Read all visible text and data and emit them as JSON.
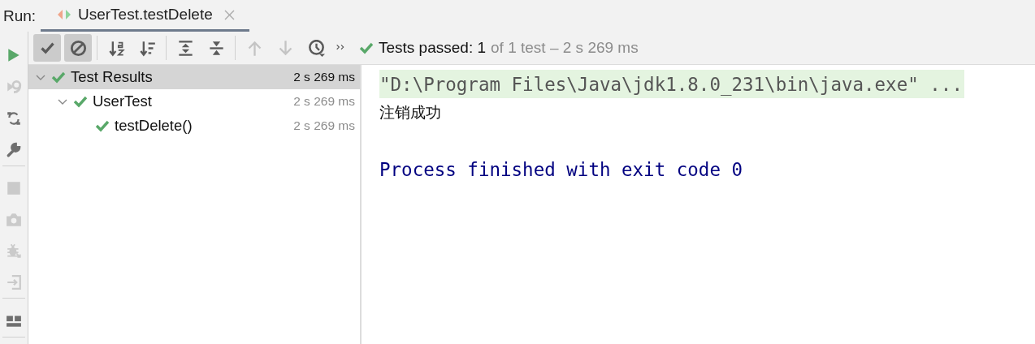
{
  "run_label": "Run:",
  "tab": {
    "label": "UserTest.testDelete",
    "selected": true
  },
  "side_tools": [
    [
      {
        "kind": "play",
        "disabled": false
      },
      {
        "kind": "rerun-failed",
        "disabled": true
      },
      {
        "kind": "toggle-rerun",
        "disabled": false
      },
      {
        "kind": "wrench",
        "disabled": false
      }
    ],
    [
      {
        "kind": "stop",
        "disabled": true
      },
      {
        "kind": "camera",
        "disabled": true
      },
      {
        "kind": "bug",
        "disabled": true
      },
      {
        "kind": "exit",
        "disabled": true
      }
    ],
    [
      {
        "kind": "layout",
        "disabled": false
      }
    ]
  ],
  "toolbar": [
    [
      {
        "kind": "check",
        "on": true
      },
      {
        "kind": "ban",
        "on": true
      }
    ],
    [
      {
        "kind": "sort-alpha",
        "on": false
      },
      {
        "kind": "sort-duration",
        "on": false
      }
    ],
    [
      {
        "kind": "expand",
        "on": false
      },
      {
        "kind": "collapse",
        "on": false
      }
    ],
    [
      {
        "kind": "up",
        "disabled": true
      },
      {
        "kind": "down",
        "disabled": true
      },
      {
        "kind": "history",
        "disabled": false
      },
      {
        "kind": "more",
        "disabled": false
      }
    ]
  ],
  "status": {
    "passed": "Tests passed: 1",
    "detail": "of 1 test – 2 s 269 ms"
  },
  "tree": [
    {
      "label": "Test Results",
      "time": "2 s 269 ms",
      "expanded": true,
      "selected": true,
      "children": [
        {
          "label": "UserTest",
          "time": "2 s 269 ms",
          "expanded": true,
          "selected": false,
          "children": [
            {
              "label": "testDelete()",
              "time": "2 s 269 ms",
              "selected": false
            }
          ]
        }
      ]
    }
  ],
  "console": [
    {
      "kind": "command",
      "text": "\"D:\\Program Files\\Java\\jdk1.8.0_231\\bin\\java.exe\" ..."
    },
    {
      "kind": "output",
      "text": "注销成功"
    },
    {
      "kind": "blank"
    },
    {
      "kind": "exit",
      "text": "Process finished with exit code 0"
    }
  ]
}
